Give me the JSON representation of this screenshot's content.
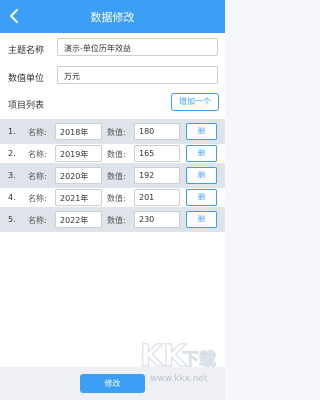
{
  "header": {
    "title": "数据修改",
    "back_icon": "chevron-left-icon"
  },
  "form": {
    "subject_label": "主题名称",
    "subject_value": "演示-单位历年效益",
    "unit_label": "数值单位",
    "unit_value": "万元"
  },
  "items_section": {
    "label": "项目列表",
    "add_label": "增加一个"
  },
  "items": [
    {
      "index": "1.",
      "name_label": "名称:",
      "name": "2018年",
      "value_label": "数值:",
      "value": "180",
      "delete_label": "删"
    },
    {
      "index": "2.",
      "name_label": "名称:",
      "name": "2019年",
      "value_label": "数值:",
      "value": "165",
      "delete_label": "删"
    },
    {
      "index": "3.",
      "name_label": "名称:",
      "name": "2020年",
      "value_label": "数值:",
      "value": "192",
      "delete_label": "删"
    },
    {
      "index": "4.",
      "name_label": "名称:",
      "name": "2021年",
      "value_label": "数值:",
      "value": "201",
      "delete_label": "删"
    },
    {
      "index": "5.",
      "name_label": "名称:",
      "name": "2022年",
      "value_label": "数值:",
      "value": "230",
      "delete_label": "删"
    }
  ],
  "footer": {
    "submit_label": "修改"
  },
  "watermark": {
    "logo_text": "KK下载",
    "url": "www.kkx.net"
  },
  "colors": {
    "accent": "#3a9ff5",
    "row_shade": "#dfe3ea"
  }
}
